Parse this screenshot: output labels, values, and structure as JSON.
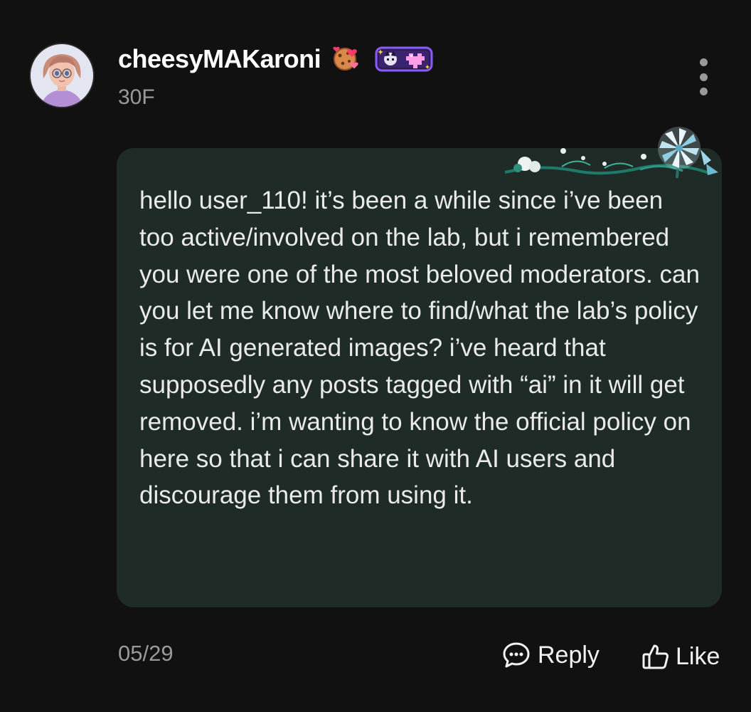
{
  "post": {
    "username": "cheesyMAKaroni",
    "post_number": "30F",
    "message": "hello user_110! it’s been a while since i’ve been too active/involved on the lab, but i remembered you were one of the most beloved moderators. can you let me know where to find/what the lab’s policy is for AI generated images? i’ve heard that supposedly any posts tagged with “ai” in it will get removed. i’m wanting to know the official policy on here so that i can share it with AI users and discourage them from using it.",
    "date": "05/29",
    "reply_label": "Reply",
    "like_label": "Like"
  },
  "icons": {
    "avatar": "avatar-portrait",
    "badge_1": "cookie-hearts-icon",
    "badge_2": "pixel-heart-frame-icon",
    "more": "more-vertical-icon",
    "reply": "speech-bubble-icon",
    "like": "thumbs-up-icon",
    "bubble_decoration": "flowers-pinwheel-decoration"
  },
  "colors": {
    "background": "#111111",
    "bubble": "#1e2b27",
    "text_primary": "#f2f2f2",
    "text_secondary": "#9a9a9a"
  }
}
